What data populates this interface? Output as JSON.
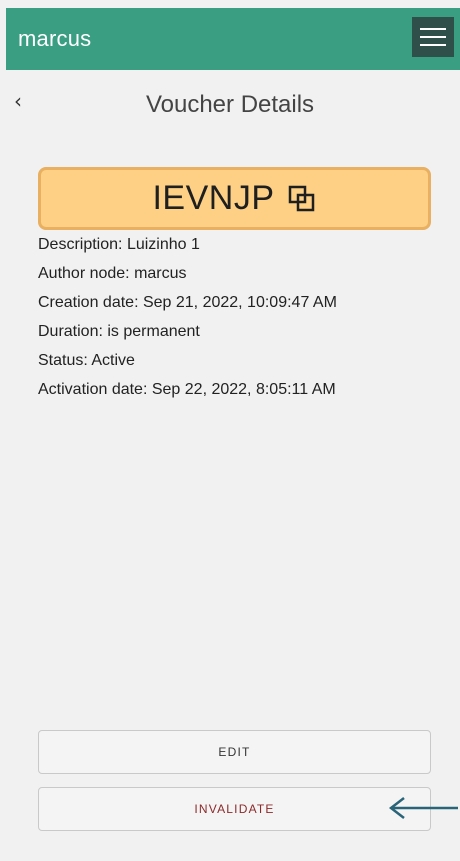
{
  "header": {
    "app_title": "marcus",
    "menu_icon": "hamburger-menu-icon",
    "bg_color": "#3a9e82"
  },
  "nav": {
    "back_glyph": "‹",
    "back_icon": "chevron-left-icon",
    "title": "Voucher Details"
  },
  "voucher": {
    "code": "IEVNJP",
    "copy_icon": "copy-icon",
    "highlight_color": "#fdd085"
  },
  "details": [
    {
      "label": "Description:",
      "value": "Luizinho 1"
    },
    {
      "label": "Author node:",
      "value": "marcus"
    },
    {
      "label": "Creation date:",
      "value": "Sep 21, 2022, 10:09:47 AM"
    },
    {
      "label": "Duration:",
      "value": "is permanent"
    },
    {
      "label": "Status:",
      "value": "Active"
    },
    {
      "label": "Activation date:",
      "value": "Sep 22, 2022, 8:05:11 AM"
    }
  ],
  "actions": {
    "edit_label": "EDIT",
    "invalidate_label": "INVALIDATE",
    "invalidate_color": "#8b2a2a"
  },
  "annotation": {
    "arrow_icon": "left-arrow-icon",
    "arrow_color": "#2a6478"
  }
}
